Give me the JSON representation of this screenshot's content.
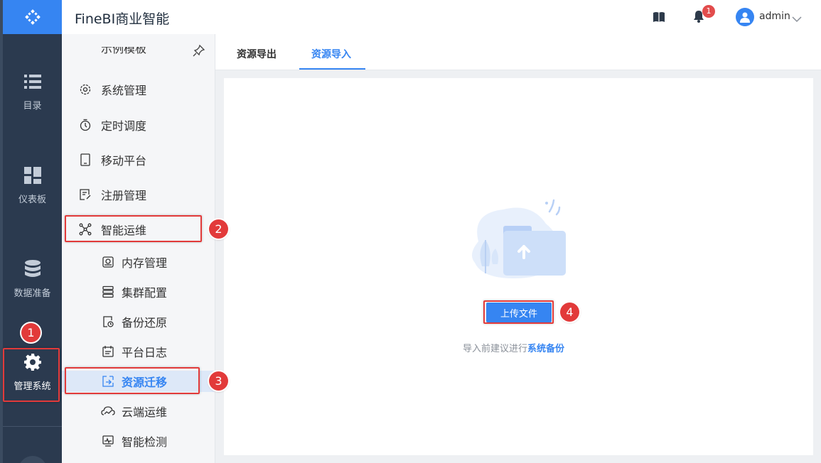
{
  "app": {
    "title": "FineBI商业智能"
  },
  "rail": {
    "items": [
      {
        "label": "目录",
        "icon": "list-icon"
      },
      {
        "label": "仪表板",
        "icon": "dashboard-icon"
      },
      {
        "label": "数据准备",
        "icon": "database-icon"
      },
      {
        "label": "管理系统",
        "icon": "gear-icon",
        "active": true
      }
    ]
  },
  "header": {
    "notification_count": "1",
    "username": "admin"
  },
  "sidebar": {
    "cut_item": "示例模板",
    "items": [
      {
        "label": "系统管理",
        "icon": "gear-outline-icon"
      },
      {
        "label": "定时调度",
        "icon": "timer-icon"
      },
      {
        "label": "移动平台",
        "icon": "tablet-icon"
      },
      {
        "label": "注册管理",
        "icon": "register-icon"
      },
      {
        "label": "智能运维",
        "icon": "network-icon"
      }
    ],
    "sub_items": [
      {
        "label": "内存管理",
        "icon": "memory-icon"
      },
      {
        "label": "集群配置",
        "icon": "cluster-icon"
      },
      {
        "label": "备份还原",
        "icon": "backup-icon"
      },
      {
        "label": "平台日志",
        "icon": "log-icon"
      },
      {
        "label": "资源迁移",
        "icon": "migrate-icon",
        "active": true
      },
      {
        "label": "云端运维",
        "icon": "cloud-icon"
      },
      {
        "label": "智能检测",
        "icon": "monitor-icon"
      }
    ]
  },
  "tabs": [
    {
      "label": "资源导出"
    },
    {
      "label": "资源导入",
      "active": true
    }
  ],
  "main": {
    "upload_label": "上传文件",
    "hint_prefix": "导入前建议进行",
    "hint_link": "系统备份"
  },
  "annotations": [
    "1",
    "2",
    "3",
    "4"
  ],
  "colors": {
    "accent": "#3685f2",
    "rail": "#2b3a4f",
    "annotation": "#e23a3a"
  }
}
